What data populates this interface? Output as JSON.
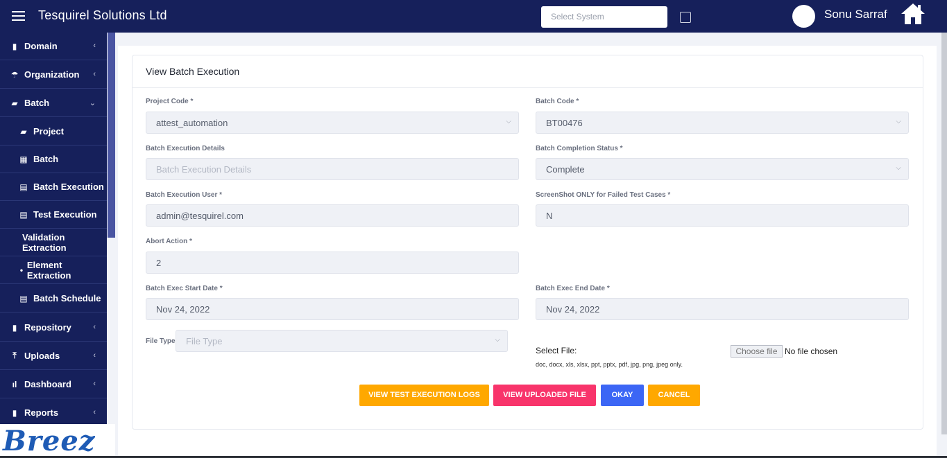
{
  "header": {
    "brand": "Tesquirel Solutions Ltd",
    "system_placeholder": "Select System",
    "user_name": "Sonu Sarraf"
  },
  "sidebar": {
    "items": [
      {
        "label": "Domain",
        "icon": "briefcase-icon",
        "glyph": "▮"
      },
      {
        "label": "Organization",
        "icon": "umbrella-icon",
        "glyph": "☂"
      },
      {
        "label": "Batch",
        "icon": "folder-icon",
        "glyph": "▰"
      },
      {
        "label": "Project",
        "icon": "folder-icon",
        "glyph": "▰"
      },
      {
        "label": "Batch",
        "icon": "grid-icon",
        "glyph": "▦"
      },
      {
        "label": "Batch Execution",
        "icon": "film-icon",
        "glyph": "▤"
      },
      {
        "label": "Test Execution",
        "icon": "film-icon",
        "glyph": "▤"
      },
      {
        "label": "Validation Extraction"
      },
      {
        "label": "Element Extraction",
        "icon": "dot-icon",
        "glyph": "•"
      },
      {
        "label": "Batch Schedule",
        "icon": "film-icon",
        "glyph": "▤"
      },
      {
        "label": "Repository",
        "icon": "briefcase-icon",
        "glyph": "▮"
      },
      {
        "label": "Uploads",
        "icon": "upload-icon",
        "glyph": "⤒"
      },
      {
        "label": "Dashboard",
        "icon": "bar-chart-icon",
        "glyph": "ıl"
      },
      {
        "label": "Reports",
        "icon": "file-icon",
        "glyph": "▮"
      }
    ]
  },
  "logo_text": "Breez",
  "form": {
    "title": "View Batch Execution",
    "project_code_label": "Project Code *",
    "project_code_value": "attest_automation",
    "batch_code_label": "Batch Code *",
    "batch_code_value": "BT00476",
    "batch_exec_details_label": "Batch Execution Details",
    "batch_exec_details_placeholder": "Batch Execution Details",
    "batch_completion_status_label": "Batch Completion Status *",
    "batch_completion_status_value": "Complete",
    "batch_exec_user_label": "Batch Execution User *",
    "batch_exec_user_value": "admin@tesquirel.com",
    "screenshot_failed_label": "ScreenShot ONLY for Failed Test Cases *",
    "screenshot_failed_value": "N",
    "abort_action_label": "Abort Action *",
    "abort_action_value": "2",
    "start_date_label": "Batch Exec Start Date *",
    "start_date_value": "Nov 24, 2022",
    "end_date_label": "Batch Exec End Date *",
    "end_date_value": "Nov 24, 2022",
    "file_type_label": "File Type",
    "file_type_placeholder": "File Type",
    "select_file_label": "Select File:",
    "file_types_note": "doc, docx, xls, xlsx, ppt, pptx, pdf, jpg, png, jpeg only.",
    "choose_file_label": "Choose file",
    "no_file_text": "No file chosen"
  },
  "buttons": {
    "view_logs": "VIEW TEST EXECUTION LOGS",
    "view_uploaded": "VIEW UPLOADED FILE",
    "okay": "OKAY",
    "cancel": "CANCEL"
  },
  "colors": {
    "navy": "#16205b",
    "amber": "#ffa800",
    "pink": "#f8346b",
    "blue": "#3c66f5"
  }
}
